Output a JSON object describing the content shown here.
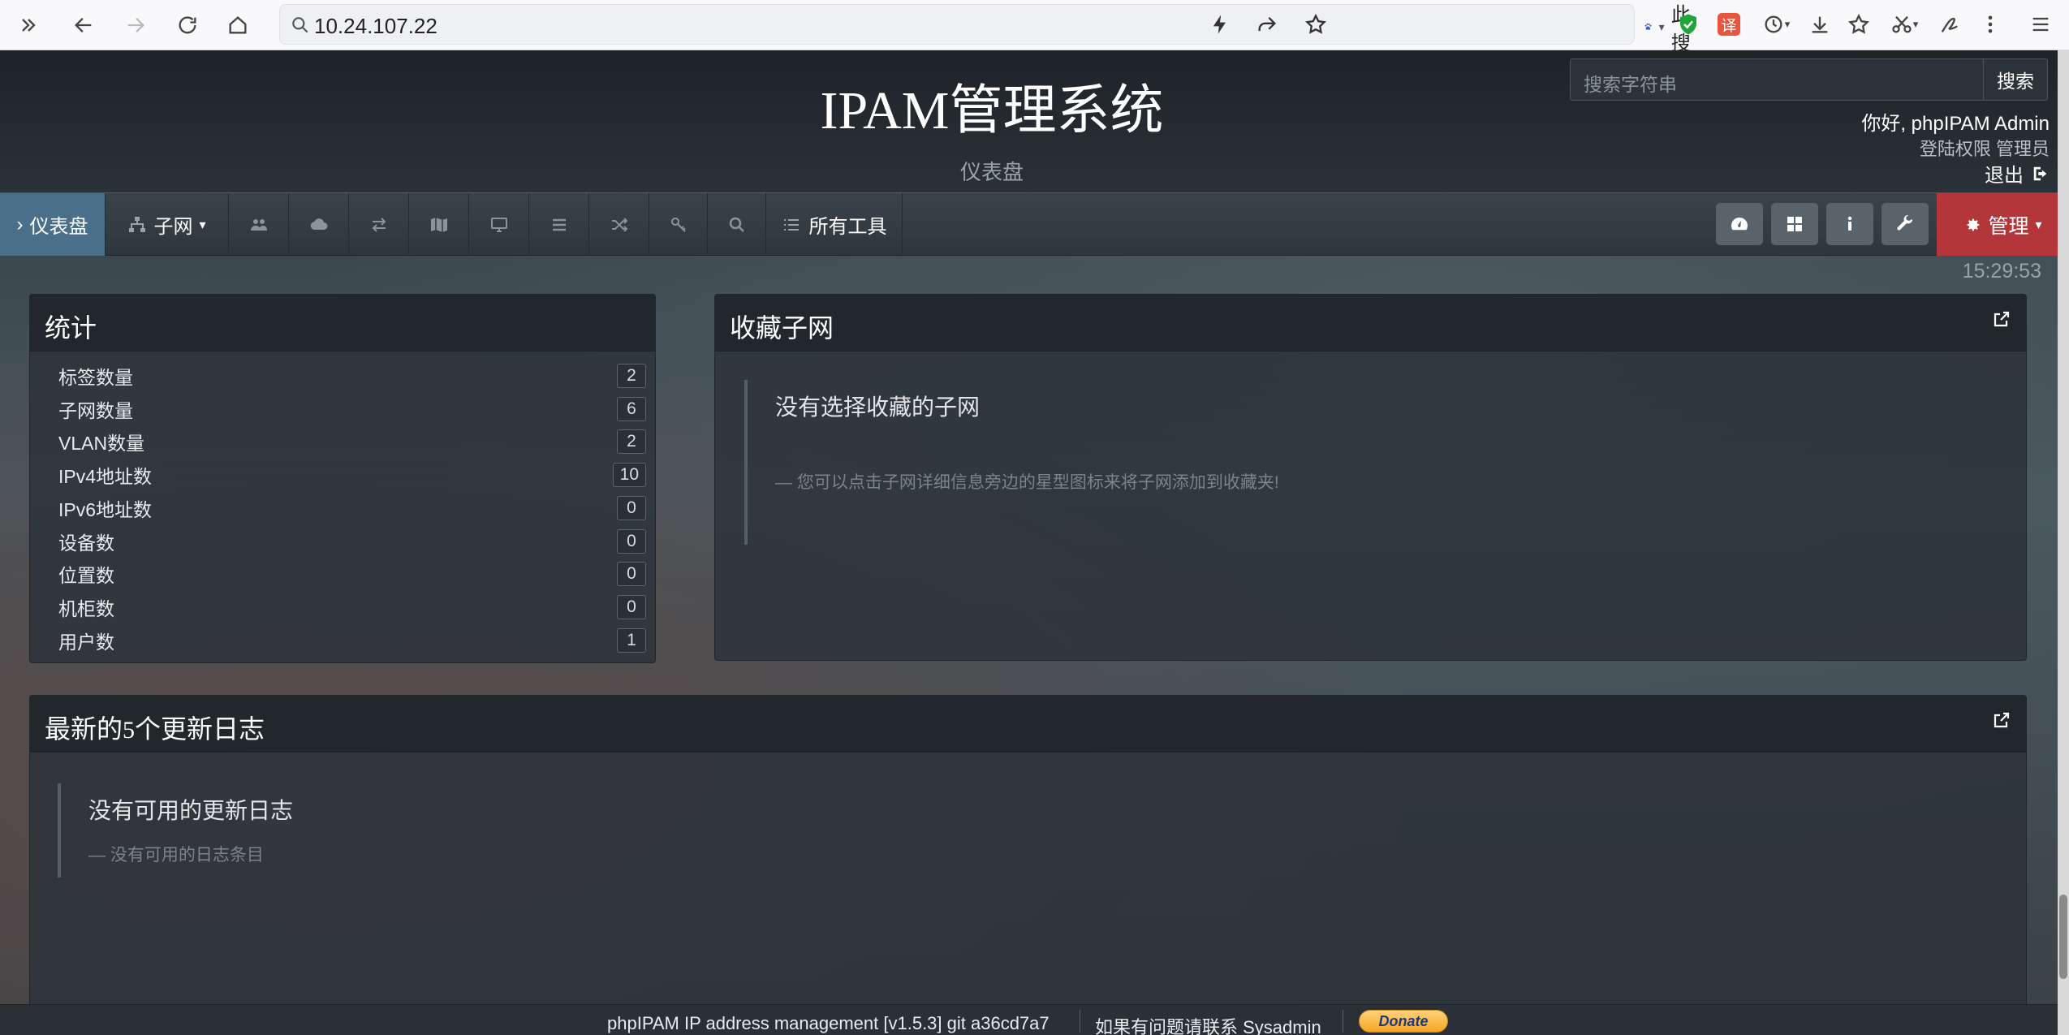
{
  "browser": {
    "url": "10.24.107.22",
    "search_engine_label": "在此搜索",
    "icons": [
      "sidebar-toggle-icon",
      "back-icon",
      "forward-icon",
      "reload-icon",
      "home-icon",
      "lightning-icon",
      "share-icon",
      "bookmark-star-icon",
      "baidu-paw-icon",
      "shield-icon",
      "translate-icon",
      "history-icon",
      "download-icon",
      "favorites-icon",
      "scissors-icon",
      "sign-icon",
      "more-icon",
      "menu-icon"
    ],
    "translate_label": "译"
  },
  "header": {
    "title": "IPAM管理系统",
    "subtitle": "仪表盘",
    "search_placeholder": "搜索字符串",
    "search_button": "搜索",
    "greeting": "你好, phpIPAM Admin",
    "permissions": "登陆权限  管理员",
    "logout": "退出"
  },
  "nav": {
    "dashboard": "仪表盘",
    "subnets": "子网",
    "tools": "所有工具",
    "admin": "管理",
    "colors": {
      "active": "#4a6f8a",
      "admin": "#b2363a"
    }
  },
  "clock": "15:29:53",
  "stats": {
    "title": "统计",
    "rows": [
      {
        "label": "标签数量",
        "value": "2"
      },
      {
        "label": "子网数量",
        "value": "6"
      },
      {
        "label": "VLAN数量",
        "value": "2"
      },
      {
        "label": "IPv4地址数",
        "value": "10"
      },
      {
        "label": "IPv6地址数",
        "value": "0"
      },
      {
        "label": "设备数",
        "value": "0"
      },
      {
        "label": "位置数",
        "value": "0"
      },
      {
        "label": "机柜数",
        "value": "0"
      },
      {
        "label": "用户数",
        "value": "1"
      }
    ]
  },
  "favorites": {
    "title": "收藏子网",
    "empty_title": "没有选择收藏的子网",
    "empty_hint": "— 您可以点击子网详细信息旁边的星型图标来将子网添加到收藏夹!"
  },
  "changelog": {
    "title_prefix": "最新的",
    "title_count": "5",
    "title_suffix": "个更新日志",
    "empty_title": "没有可用的更新日志",
    "empty_hint": "— 没有可用的日志条目"
  },
  "footer": {
    "version": "phpIPAM IP address management [v1.5.3] git a36cd7a7",
    "contact": "如果有问题请联系 Sysadmin",
    "donate": "Donate"
  }
}
